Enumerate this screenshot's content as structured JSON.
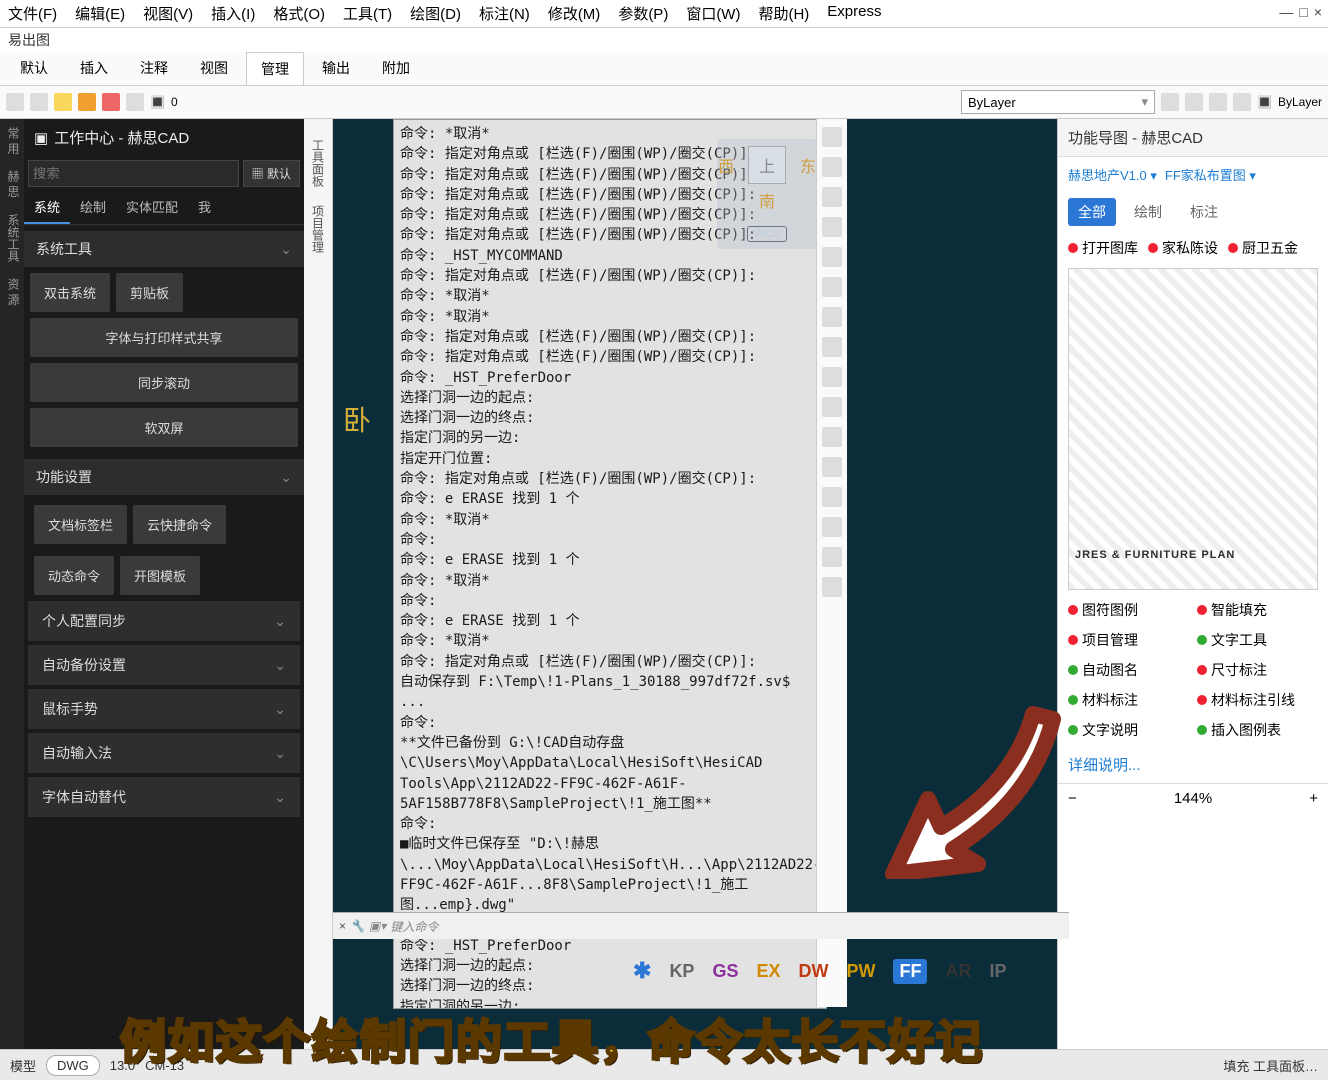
{
  "window": {
    "minimize": "—",
    "fullscreen": "□",
    "close": "×"
  },
  "menubar": [
    "文件(F)",
    "编辑(E)",
    "视图(V)",
    "插入(I)",
    "格式(O)",
    "工具(T)",
    "绘图(D)",
    "标注(N)",
    "修改(M)",
    "参数(P)",
    "窗口(W)",
    "帮助(H)",
    "Express"
  ],
  "subtitle": "易出图",
  "ribbon_tabs": [
    "默认",
    "插入",
    "注释",
    "视图",
    "管理",
    "输出",
    "附加"
  ],
  "ribbon_active": 4,
  "toolbar2": {
    "layer_left": "0",
    "layer_right_sel": "ByLayer",
    "layer_right_txt": "ByLayer"
  },
  "left": {
    "title": "工作中心 - 赫思CAD",
    "search_placeholder": "搜索",
    "search_sel": "默认",
    "tabs": [
      "系统",
      "绘制",
      "实体匹配",
      "我"
    ],
    "sections": {
      "sys": {
        "label": "系统工具",
        "btns": [
          "双击系统",
          "剪贴板",
          "字体与打印样式共享",
          "同步滚动",
          "软双屏"
        ]
      },
      "func": {
        "label": "功能设置",
        "rows": [
          "文档标签栏",
          "云快捷命令",
          "动态命令",
          "开图模板",
          "个人配置同步",
          "自动备份设置",
          "鼠标手势",
          "自动输入法",
          "字体自动替代"
        ]
      }
    },
    "side_tabs": [
      "常 用",
      "赫 思",
      "系统工具",
      "资 源"
    ]
  },
  "canvas": {
    "side": [
      "工具面板",
      "项目管理"
    ],
    "room_text": "卧",
    "compass": {
      "w": "西",
      "t": "上",
      "e": "东",
      "s": "南",
      "wcs": "WCS"
    }
  },
  "cmdlog": "命令: *取消*\n命令: 指定对角点或 [栏选(F)/圈围(WP)/圈交(CP)]:\n命令: 指定对角点或 [栏选(F)/圈围(WP)/圈交(CP)]:\n命令: 指定对角点或 [栏选(F)/圈围(WP)/圈交(CP)]:\n命令: 指定对角点或 [栏选(F)/圈围(WP)/圈交(CP)]:\n命令: 指定对角点或 [栏选(F)/圈围(WP)/圈交(CP)]:\n命令: _HST_MYCOMMAND\n命令: 指定对角点或 [栏选(F)/圈围(WP)/圈交(CP)]:\n命令: *取消*\n命令: *取消*\n命令: 指定对角点或 [栏选(F)/圈围(WP)/圈交(CP)]:\n命令: 指定对角点或 [栏选(F)/圈围(WP)/圈交(CP)]:\n命令: _HST_PreferDoor\n选择门洞一边的起点:\n选择门洞一边的终点:\n指定门洞的另一边:\n指定开门位置:\n命令: 指定对角点或 [栏选(F)/圈围(WP)/圈交(CP)]:\n命令: e ERASE 找到 1 个\n命令: *取消*\n命令:\n命令: e ERASE 找到 1 个\n命令: *取消*\n命令:\n命令: e ERASE 找到 1 个\n命令: *取消*\n命令: 指定对角点或 [栏选(F)/圈围(WP)/圈交(CP)]:\n自动保存到 F:\\Temp\\!1-Plans_1_30188_997df72f.sv$ ...\n命令:\n**文件已备份到 G:\\!CAD自动存盘\\C\\Users\\Moy\\AppData\\Local\\HesiSoft\\HesiCAD Tools\\App\\2112AD22-FF9C-462F-A61F-5AF158B778F8\\SampleProject\\!1_施工图**\n命令:\n■临时文件已保存至 \"D:\\!赫思\\...\\Moy\\AppData\\Local\\HesiSoft\\H...\\App\\2112AD22-FF9C-462F-A61F...8F8\\SampleProject\\!1_施工图...emp}.dwg\"\n命令: 指定对角点或 [栏选...)/圈交(CP)]:\n命令: _HST_PreferDoor\n选择门洞一边的起点:\n选择门洞一边的终点:\n指定门洞的另一边:\n指定开门位置:",
  "cmdinput": {
    "x": "×",
    "wrench": "🔧",
    "term": "▣▾",
    "placeholder": "键入命令"
  },
  "quickbar": [
    {
      "cls": "star",
      "t": "✱"
    },
    {
      "cls": "kp",
      "t": "KP"
    },
    {
      "cls": "gs",
      "t": "GS"
    },
    {
      "cls": "ex",
      "t": "EX"
    },
    {
      "cls": "dw",
      "t": "DW"
    },
    {
      "cls": "pw",
      "t": "PW"
    },
    {
      "cls": "ff",
      "t": "FF"
    },
    {
      "cls": "ar",
      "t": "AR"
    },
    {
      "cls": "ip",
      "t": "IP"
    }
  ],
  "right": {
    "title": "功能导图 - 赫思CAD",
    "sel1": "赫思地产V1.0",
    "sel2": "FF家私布置图",
    "filters": [
      "全部",
      "绘制",
      "标注"
    ],
    "chips": [
      {
        "c": "#e23",
        "t": "打开图库"
      },
      {
        "c": "#e23",
        "t": "家私陈设"
      },
      {
        "c": "#e23",
        "t": "厨卫五金"
      }
    ],
    "preview_caption": "JRES & FURNITURE PLAN",
    "legend": [
      {
        "c": "#e23",
        "t": "图符图例"
      },
      {
        "c": "#e23",
        "t": "智能填充"
      },
      {
        "c": "#e23",
        "t": "项目管理"
      },
      {
        "c": "#3a3",
        "t": "文字工具"
      },
      {
        "c": "#3a3",
        "t": "自动图名"
      },
      {
        "c": "#e23",
        "t": "尺寸标注"
      },
      {
        "c": "#3a3",
        "t": "材料标注"
      },
      {
        "c": "#e23",
        "t": "材料标注引线"
      },
      {
        "c": "#3a3",
        "t": "文字说明"
      },
      {
        "c": "#3a3",
        "t": "插入图例表"
      }
    ],
    "more": "详细说明...",
    "zoom": {
      "minus": "−",
      "pct": "144%",
      "plus": "+"
    }
  },
  "statusbar": {
    "tabs": [
      "模型",
      "DWG"
    ],
    "coords": "13.0",
    "extra": "CM-13",
    "right": "填充  工具面板…"
  },
  "caption": "例如这个绘制门的工具，命令太长不好记"
}
